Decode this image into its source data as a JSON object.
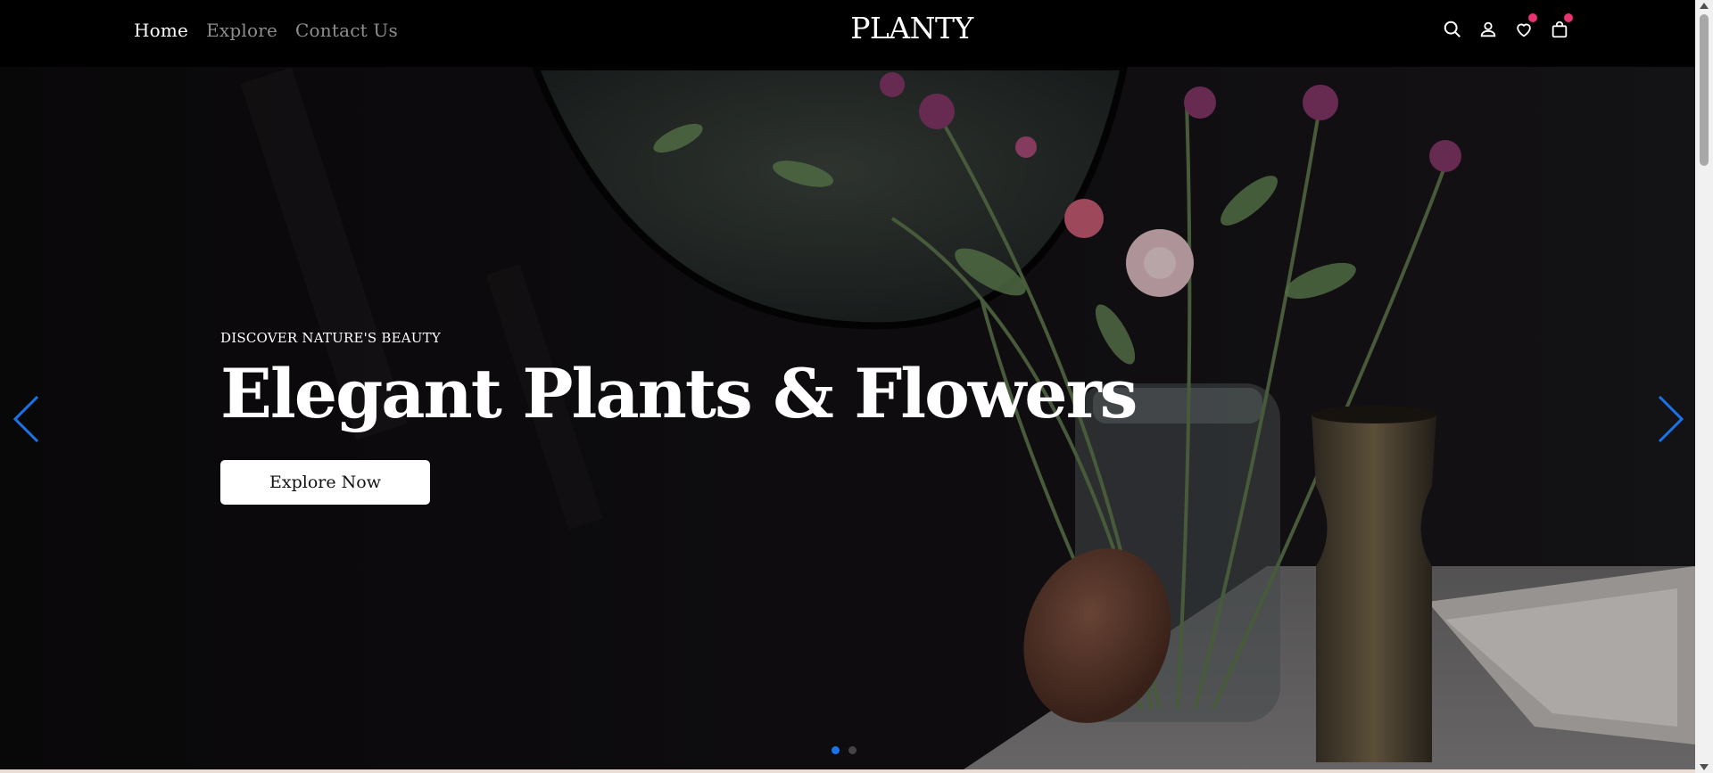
{
  "header": {
    "nav": [
      {
        "label": "Home",
        "active": true
      },
      {
        "label": "Explore",
        "active": false
      },
      {
        "label": "Contact Us",
        "active": false
      }
    ],
    "brand": "PLANTY",
    "icons": [
      "search-icon",
      "user-icon",
      "heart-icon",
      "cart-icon"
    ],
    "badge_color": "#e8336f"
  },
  "hero": {
    "eyebrow": "DISCOVER NATURE'S BEAUTY",
    "headline": "Elegant Plants & Flowers",
    "cta_label": "Explore Now",
    "arrow_color": "#1a73e8",
    "slides": [
      {
        "active": true
      },
      {
        "active": false
      }
    ]
  },
  "colors": {
    "accent": "#1a73e8",
    "active_dot": "#1a73e8",
    "inactive_dot": "#444444"
  }
}
